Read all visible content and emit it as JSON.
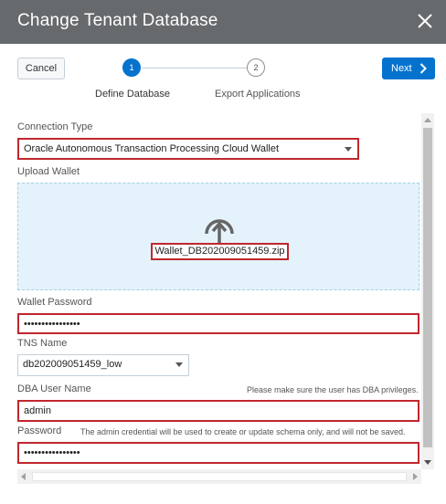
{
  "dialog": {
    "title": "Change Tenant Database",
    "close_icon": "close-icon"
  },
  "toolbar": {
    "cancel_label": "Cancel",
    "next_label": "Next",
    "next_icon": "chevron-right-icon",
    "accent": "#0572ce"
  },
  "train": {
    "steps": [
      {
        "number": "1",
        "label": "Define Database",
        "state": "current"
      },
      {
        "number": "2",
        "label": "Export Applications",
        "state": "pending"
      }
    ]
  },
  "form": {
    "connection_type": {
      "label": "Connection Type",
      "value": "Oracle Autonomous Transaction Processing Cloud Wallet"
    },
    "upload_wallet": {
      "label": "Upload Wallet",
      "icon": "upload-arrow-icon",
      "file_name": "Wallet_DB202009051459.zip"
    },
    "wallet_password": {
      "label": "Wallet Password",
      "value": "••••••••••••••••"
    },
    "tns_name": {
      "label": "TNS Name",
      "value": "db202009051459_low"
    },
    "dba_user_name": {
      "label": "DBA User Name",
      "hint": "Please make sure the user has DBA privileges.",
      "value": "admin"
    },
    "password": {
      "label": "Password",
      "hint": "The admin credential will be used to create or update schema only, and will not be saved.",
      "value": "••••••••••••••••"
    }
  },
  "highlight_color": "#c0272d"
}
